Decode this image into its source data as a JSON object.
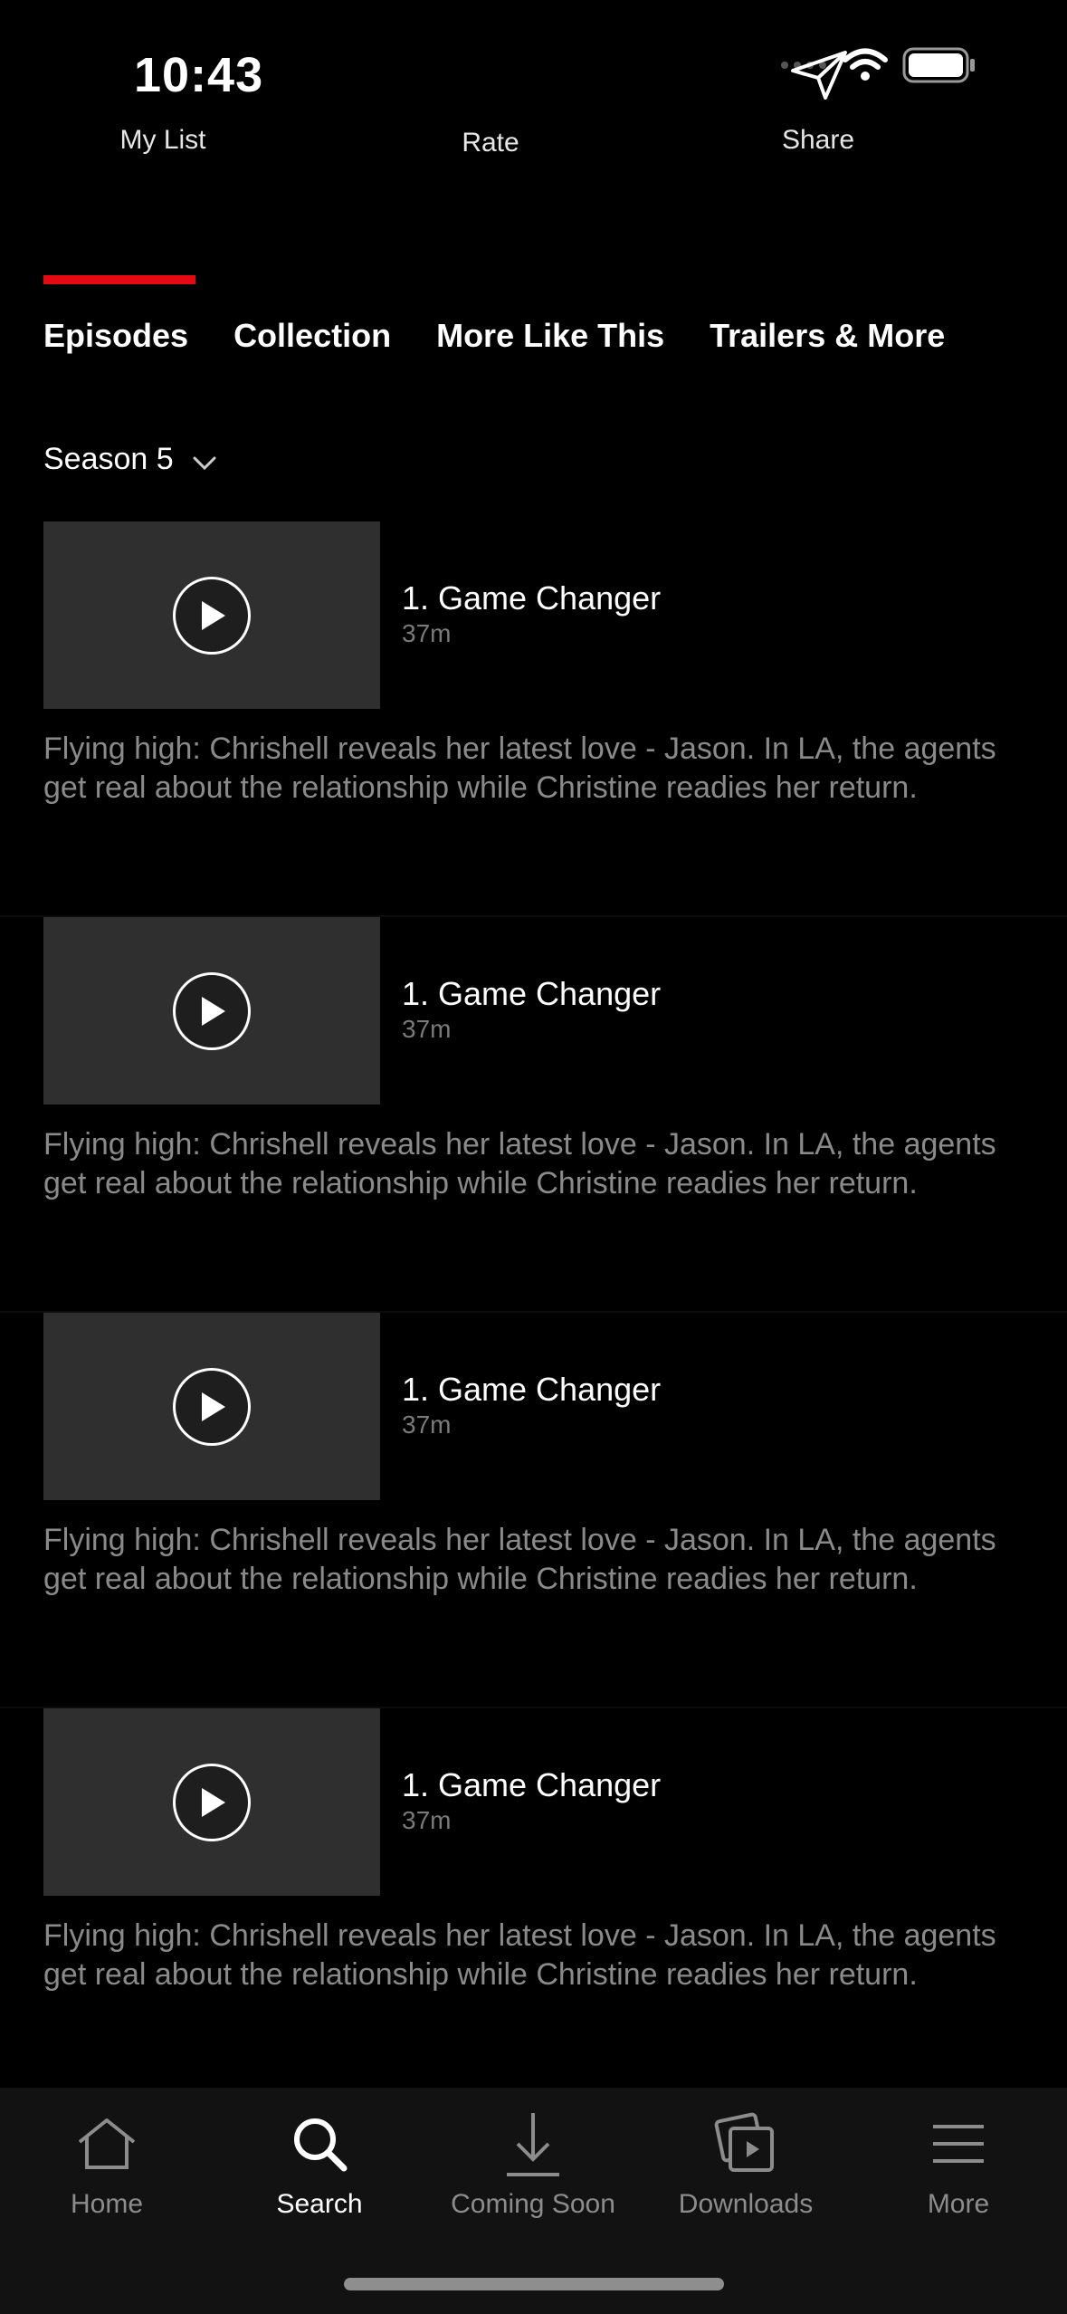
{
  "status_bar": {
    "time": "10:43"
  },
  "actions": {
    "my_list": "My List",
    "rate": "Rate",
    "share": "Share"
  },
  "tabs": [
    {
      "label": "Episodes",
      "active": true
    },
    {
      "label": "Collection"
    },
    {
      "label": "More Like This"
    },
    {
      "label": "Trailers & More"
    }
  ],
  "season_selector": {
    "label": "Season 5"
  },
  "episodes": [
    {
      "title": "1. Game Changer",
      "duration": "37m",
      "description": "Flying high: Chrishell reveals her latest love - Jason. In LA, the agents get real about the relationship while Christine readies her return."
    },
    {
      "title": "1. Game Changer",
      "duration": "37m",
      "description": "Flying high: Chrishell reveals her latest love - Jason. In LA, the agents get real about the relationship while Christine readies her return."
    },
    {
      "title": "1. Game Changer",
      "duration": "37m",
      "description": "Flying high: Chrishell reveals her latest love - Jason. In LA, the agents get real about the relationship while Christine readies her return."
    },
    {
      "title": "1. Game Changer",
      "duration": "37m",
      "description": "Flying high: Chrishell reveals her latest love - Jason. In LA, the agents get real about the relationship while Christine readies her return."
    }
  ],
  "bottom_nav": {
    "items": [
      {
        "label": "Home",
        "icon": "home-icon"
      },
      {
        "label": "Search",
        "icon": "search-icon",
        "active": true
      },
      {
        "label": "Coming Soon",
        "icon": "download-arrow-icon"
      },
      {
        "label": "Downloads",
        "icon": "downloads-icon"
      },
      {
        "label": "More",
        "icon": "menu-icon"
      }
    ]
  },
  "colors": {
    "accent": "#e50914",
    "background": "#000000",
    "thumbnail": "#2f2f2f",
    "secondary_text": "#8a8a8a",
    "nav_background": "#121212"
  }
}
